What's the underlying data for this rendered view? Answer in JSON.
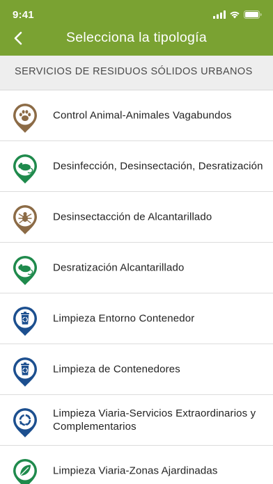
{
  "status_bar": {
    "time": "9:41"
  },
  "nav": {
    "title": "Selecciona la tipología"
  },
  "section": {
    "title": "SERVICIOS DE RESIDUOS SÓLIDOS URBANOS"
  },
  "colors": {
    "brand": "#7aa232",
    "brown": "#8c6b46",
    "green": "#1f8a4c",
    "blue": "#1c4f8f"
  },
  "items": [
    {
      "label": "Control Animal-Animales Vagabundos",
      "icon": "paw-icon",
      "color": "brown"
    },
    {
      "label": "Desinfección, Desinsectación, Desratización",
      "icon": "rat-icon",
      "color": "green"
    },
    {
      "label": "Desinsectacción de Alcantarillado",
      "icon": "bug-icon",
      "color": "brown"
    },
    {
      "label": "Desratización Alcantarillado",
      "icon": "rat-icon",
      "color": "green"
    },
    {
      "label": "Limpieza Entorno Contenedor",
      "icon": "recycle-bin-icon",
      "color": "blue"
    },
    {
      "label": "Limpieza de Contenedores",
      "icon": "recycle-bin-icon",
      "color": "blue"
    },
    {
      "label": "Limpieza Viaria-Servicios Extraordinarios y Complementarios",
      "icon": "recycle-icon",
      "color": "blue"
    },
    {
      "label": "Limpieza Viaria-Zonas Ajardinadas",
      "icon": "leaf-icon",
      "color": "green"
    }
  ]
}
